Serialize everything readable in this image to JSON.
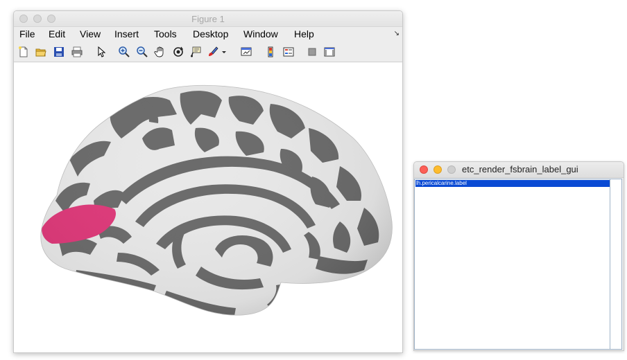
{
  "figure_window": {
    "title": "Figure 1",
    "menu": [
      "File",
      "Edit",
      "View",
      "Insert",
      "Tools",
      "Desktop",
      "Window",
      "Help"
    ],
    "toolbar_icons": [
      "new-figure-icon",
      "open-file-icon",
      "save-icon",
      "print-icon",
      "edit-plot-arrow-icon",
      "zoom-in-icon",
      "zoom-out-icon",
      "pan-hand-icon",
      "rotate-3d-icon",
      "data-cursor-icon",
      "brush-icon",
      "brush-dropdown-icon",
      "link-plot-icon",
      "insert-colorbar-icon",
      "insert-legend-icon",
      "hide-plot-tools-icon",
      "show-plot-tools-icon"
    ],
    "surface": {
      "description_colors": {
        "gyri": "#e8e8e8",
        "sulci": "#6b6b6b",
        "label_overlay": "#de3a7a"
      }
    }
  },
  "label_gui_window": {
    "title": "etc_render_fsbrain_label_gui",
    "labels": [
      "lh.pericalcarine.label"
    ],
    "selected_index": 0,
    "colors": {
      "selection": "#0a4ad4",
      "close": "#fc5f57",
      "minimize": "#fdbc2e",
      "zoom": "#cfcfcf"
    }
  }
}
